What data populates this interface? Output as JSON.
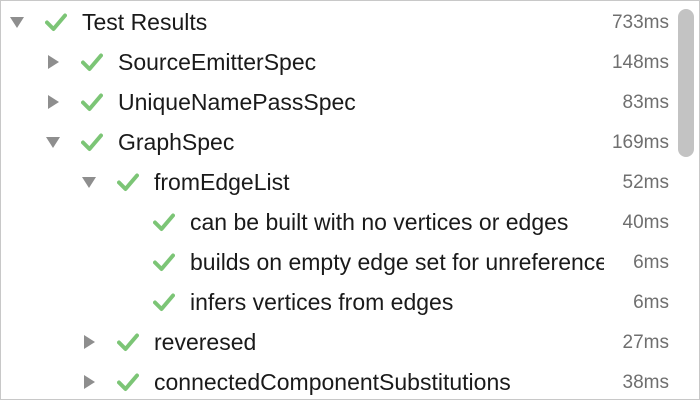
{
  "colors": {
    "pass_check": "#7cc576",
    "disclosure_arrow": "#8e8e8e",
    "duration_text": "#6f6f6f",
    "scroll_thumb": "#c3c3c3"
  },
  "icons": {
    "status": "checkmark-icon",
    "expanded": "triangle-down-icon",
    "collapsed": "triangle-right-icon"
  },
  "tree": {
    "rows": [
      {
        "label": "Test Results",
        "duration": "733ms",
        "status": "passed",
        "expanded": true,
        "has_children": true,
        "depth": 0
      },
      {
        "label": "SourceEmitterSpec",
        "duration": "148ms",
        "status": "passed",
        "expanded": false,
        "has_children": true,
        "depth": 1
      },
      {
        "label": "UniqueNamePassSpec",
        "duration": "83ms",
        "status": "passed",
        "expanded": false,
        "has_children": true,
        "depth": 1
      },
      {
        "label": "GraphSpec",
        "duration": "169ms",
        "status": "passed",
        "expanded": true,
        "has_children": true,
        "depth": 1
      },
      {
        "label": "fromEdgeList",
        "duration": "52ms",
        "status": "passed",
        "expanded": true,
        "has_children": true,
        "depth": 2
      },
      {
        "label": "can be built with no vertices or edges",
        "duration": "40ms",
        "status": "passed",
        "expanded": false,
        "has_children": false,
        "depth": 3
      },
      {
        "label": "builds on empty edge set for unreferenced vertices",
        "duration": "6ms",
        "status": "passed",
        "expanded": false,
        "has_children": false,
        "depth": 3
      },
      {
        "label": "infers vertices from edges",
        "duration": "6ms",
        "status": "passed",
        "expanded": false,
        "has_children": false,
        "depth": 3
      },
      {
        "label": "reveresed",
        "duration": "27ms",
        "status": "passed",
        "expanded": false,
        "has_children": true,
        "depth": 2
      },
      {
        "label": "connectedComponentSubstitutions",
        "duration": "38ms",
        "status": "passed",
        "expanded": false,
        "has_children": true,
        "depth": 2
      }
    ]
  }
}
